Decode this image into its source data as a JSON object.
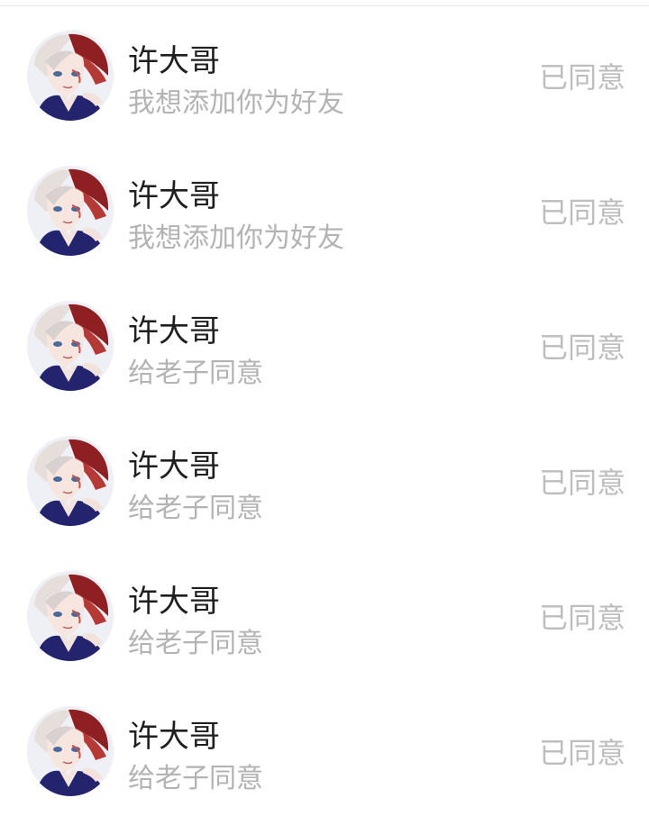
{
  "requests": [
    {
      "name": "许大哥",
      "message": "我想添加你为好友",
      "status": "已同意",
      "avatar_icon": "anime-avatar-icon"
    },
    {
      "name": "许大哥",
      "message": "我想添加你为好友",
      "status": "已同意",
      "avatar_icon": "anime-avatar-icon"
    },
    {
      "name": "许大哥",
      "message": "给老子同意",
      "status": "已同意",
      "avatar_icon": "anime-avatar-icon"
    },
    {
      "name": "许大哥",
      "message": "给老子同意",
      "status": "已同意",
      "avatar_icon": "anime-avatar-icon"
    },
    {
      "name": "许大哥",
      "message": "给老子同意",
      "status": "已同意",
      "avatar_icon": "anime-avatar-icon"
    },
    {
      "name": "许大哥",
      "message": "给老子同意",
      "status": "已同意",
      "avatar_icon": "anime-avatar-icon"
    }
  ],
  "colors": {
    "name_text": "#1f1f1f",
    "message_text": "#b3b3b3",
    "status_text": "#bdbdbd",
    "divider": "#e8e8e8"
  }
}
